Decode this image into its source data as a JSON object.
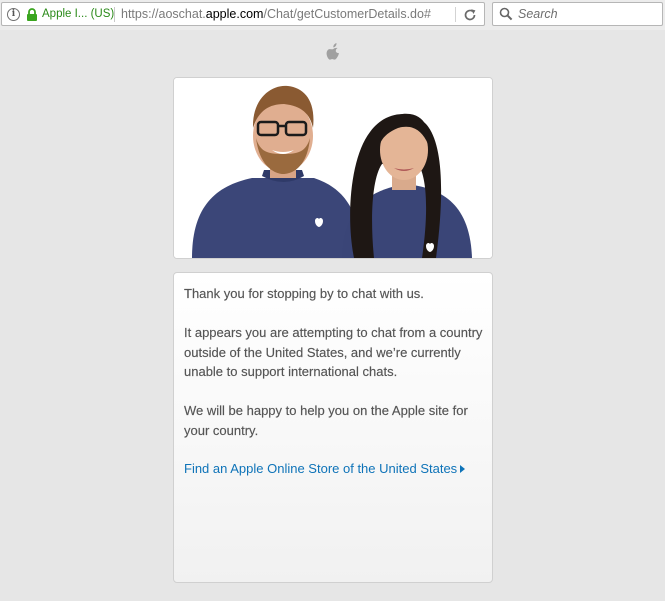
{
  "browser": {
    "identity_label": "Apple I... (US)",
    "url_prefix": "https://aoschat.",
    "url_domain": "apple.com",
    "url_path": "/Chat/getCustomerDetails.do#",
    "search_placeholder": "Search"
  },
  "page": {
    "message": {
      "greeting": "Thank you for stopping by to chat with us.",
      "body": "It appears you are attempting to chat from a country outside of the United States, and we’re currently unable to support international chats.",
      "help": "We will be happy to help you on the Apple site for your country.",
      "link_label": "Find an Apple Online Store of the United States"
    }
  },
  "icons": {
    "info": "info-icon",
    "lock": "lock-icon",
    "reload": "reload-icon",
    "search": "search-icon",
    "logo": "apple-logo-icon",
    "link_arrow": "arrow-right-icon"
  },
  "colors": {
    "background": "#e6e6e6",
    "identity_green": "#2a8a18",
    "link_blue": "#0e73b8",
    "text_gray": "#555555",
    "shirt_navy": "#3a4577"
  }
}
